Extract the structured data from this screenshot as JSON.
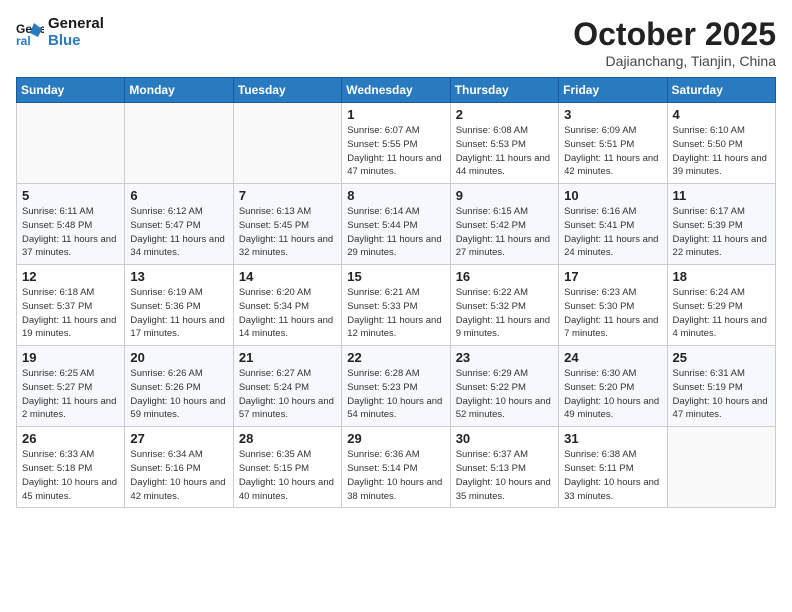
{
  "logo": {
    "line1": "General",
    "line2": "Blue"
  },
  "title": "October 2025",
  "subtitle": "Dajianchang, Tianjin, China",
  "weekdays": [
    "Sunday",
    "Monday",
    "Tuesday",
    "Wednesday",
    "Thursday",
    "Friday",
    "Saturday"
  ],
  "weeks": [
    [
      {
        "day": "",
        "info": ""
      },
      {
        "day": "",
        "info": ""
      },
      {
        "day": "",
        "info": ""
      },
      {
        "day": "1",
        "info": "Sunrise: 6:07 AM\nSunset: 5:55 PM\nDaylight: 11 hours and 47 minutes."
      },
      {
        "day": "2",
        "info": "Sunrise: 6:08 AM\nSunset: 5:53 PM\nDaylight: 11 hours and 44 minutes."
      },
      {
        "day": "3",
        "info": "Sunrise: 6:09 AM\nSunset: 5:51 PM\nDaylight: 11 hours and 42 minutes."
      },
      {
        "day": "4",
        "info": "Sunrise: 6:10 AM\nSunset: 5:50 PM\nDaylight: 11 hours and 39 minutes."
      }
    ],
    [
      {
        "day": "5",
        "info": "Sunrise: 6:11 AM\nSunset: 5:48 PM\nDaylight: 11 hours and 37 minutes."
      },
      {
        "day": "6",
        "info": "Sunrise: 6:12 AM\nSunset: 5:47 PM\nDaylight: 11 hours and 34 minutes."
      },
      {
        "day": "7",
        "info": "Sunrise: 6:13 AM\nSunset: 5:45 PM\nDaylight: 11 hours and 32 minutes."
      },
      {
        "day": "8",
        "info": "Sunrise: 6:14 AM\nSunset: 5:44 PM\nDaylight: 11 hours and 29 minutes."
      },
      {
        "day": "9",
        "info": "Sunrise: 6:15 AM\nSunset: 5:42 PM\nDaylight: 11 hours and 27 minutes."
      },
      {
        "day": "10",
        "info": "Sunrise: 6:16 AM\nSunset: 5:41 PM\nDaylight: 11 hours and 24 minutes."
      },
      {
        "day": "11",
        "info": "Sunrise: 6:17 AM\nSunset: 5:39 PM\nDaylight: 11 hours and 22 minutes."
      }
    ],
    [
      {
        "day": "12",
        "info": "Sunrise: 6:18 AM\nSunset: 5:37 PM\nDaylight: 11 hours and 19 minutes."
      },
      {
        "day": "13",
        "info": "Sunrise: 6:19 AM\nSunset: 5:36 PM\nDaylight: 11 hours and 17 minutes."
      },
      {
        "day": "14",
        "info": "Sunrise: 6:20 AM\nSunset: 5:34 PM\nDaylight: 11 hours and 14 minutes."
      },
      {
        "day": "15",
        "info": "Sunrise: 6:21 AM\nSunset: 5:33 PM\nDaylight: 11 hours and 12 minutes."
      },
      {
        "day": "16",
        "info": "Sunrise: 6:22 AM\nSunset: 5:32 PM\nDaylight: 11 hours and 9 minutes."
      },
      {
        "day": "17",
        "info": "Sunrise: 6:23 AM\nSunset: 5:30 PM\nDaylight: 11 hours and 7 minutes."
      },
      {
        "day": "18",
        "info": "Sunrise: 6:24 AM\nSunset: 5:29 PM\nDaylight: 11 hours and 4 minutes."
      }
    ],
    [
      {
        "day": "19",
        "info": "Sunrise: 6:25 AM\nSunset: 5:27 PM\nDaylight: 11 hours and 2 minutes."
      },
      {
        "day": "20",
        "info": "Sunrise: 6:26 AM\nSunset: 5:26 PM\nDaylight: 10 hours and 59 minutes."
      },
      {
        "day": "21",
        "info": "Sunrise: 6:27 AM\nSunset: 5:24 PM\nDaylight: 10 hours and 57 minutes."
      },
      {
        "day": "22",
        "info": "Sunrise: 6:28 AM\nSunset: 5:23 PM\nDaylight: 10 hours and 54 minutes."
      },
      {
        "day": "23",
        "info": "Sunrise: 6:29 AM\nSunset: 5:22 PM\nDaylight: 10 hours and 52 minutes."
      },
      {
        "day": "24",
        "info": "Sunrise: 6:30 AM\nSunset: 5:20 PM\nDaylight: 10 hours and 49 minutes."
      },
      {
        "day": "25",
        "info": "Sunrise: 6:31 AM\nSunset: 5:19 PM\nDaylight: 10 hours and 47 minutes."
      }
    ],
    [
      {
        "day": "26",
        "info": "Sunrise: 6:33 AM\nSunset: 5:18 PM\nDaylight: 10 hours and 45 minutes."
      },
      {
        "day": "27",
        "info": "Sunrise: 6:34 AM\nSunset: 5:16 PM\nDaylight: 10 hours and 42 minutes."
      },
      {
        "day": "28",
        "info": "Sunrise: 6:35 AM\nSunset: 5:15 PM\nDaylight: 10 hours and 40 minutes."
      },
      {
        "day": "29",
        "info": "Sunrise: 6:36 AM\nSunset: 5:14 PM\nDaylight: 10 hours and 38 minutes."
      },
      {
        "day": "30",
        "info": "Sunrise: 6:37 AM\nSunset: 5:13 PM\nDaylight: 10 hours and 35 minutes."
      },
      {
        "day": "31",
        "info": "Sunrise: 6:38 AM\nSunset: 5:11 PM\nDaylight: 10 hours and 33 minutes."
      },
      {
        "day": "",
        "info": ""
      }
    ]
  ]
}
